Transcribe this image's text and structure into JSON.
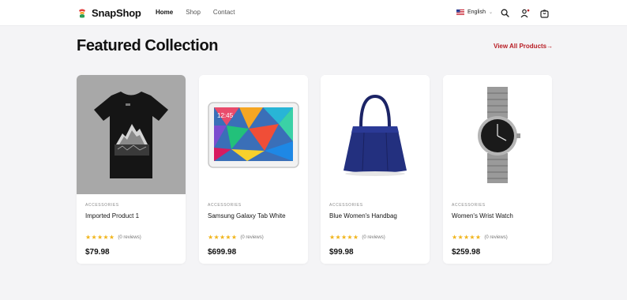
{
  "header": {
    "brand": "SnapShop",
    "nav": [
      {
        "label": "Home",
        "active": true
      },
      {
        "label": "Shop",
        "active": false
      },
      {
        "label": "Contact",
        "active": false
      }
    ],
    "language": "English"
  },
  "section": {
    "title": "Featured Collection",
    "view_all": "View All Products→"
  },
  "products": [
    {
      "category": "ACCESSORIES",
      "name": "Imported Product 1",
      "rating": 5,
      "reviews": "(0 reviews)",
      "price": "$79.98",
      "image": "black-mountain-tshirt"
    },
    {
      "category": "ACCESSORIES",
      "name": "Samsung Galaxy Tab White",
      "rating": 5,
      "reviews": "(0 reviews)",
      "price": "$699.98",
      "image": "tablet"
    },
    {
      "category": "ACCESSORIES",
      "name": "Blue Women's Handbag",
      "rating": 5,
      "reviews": "(0 reviews)",
      "price": "$99.98",
      "image": "handbag"
    },
    {
      "category": "ACCESSORIES",
      "name": "Women's Wrist Watch",
      "rating": 5,
      "reviews": "(0 reviews)",
      "price": "$259.98",
      "image": "wrist-watch"
    }
  ],
  "icons": {
    "search": "search-icon",
    "user": "user-icon",
    "cart": "cart-icon"
  },
  "colors": {
    "accent": "#b81d24",
    "star": "#f1b51c",
    "page_bg": "#f4f4f6"
  }
}
